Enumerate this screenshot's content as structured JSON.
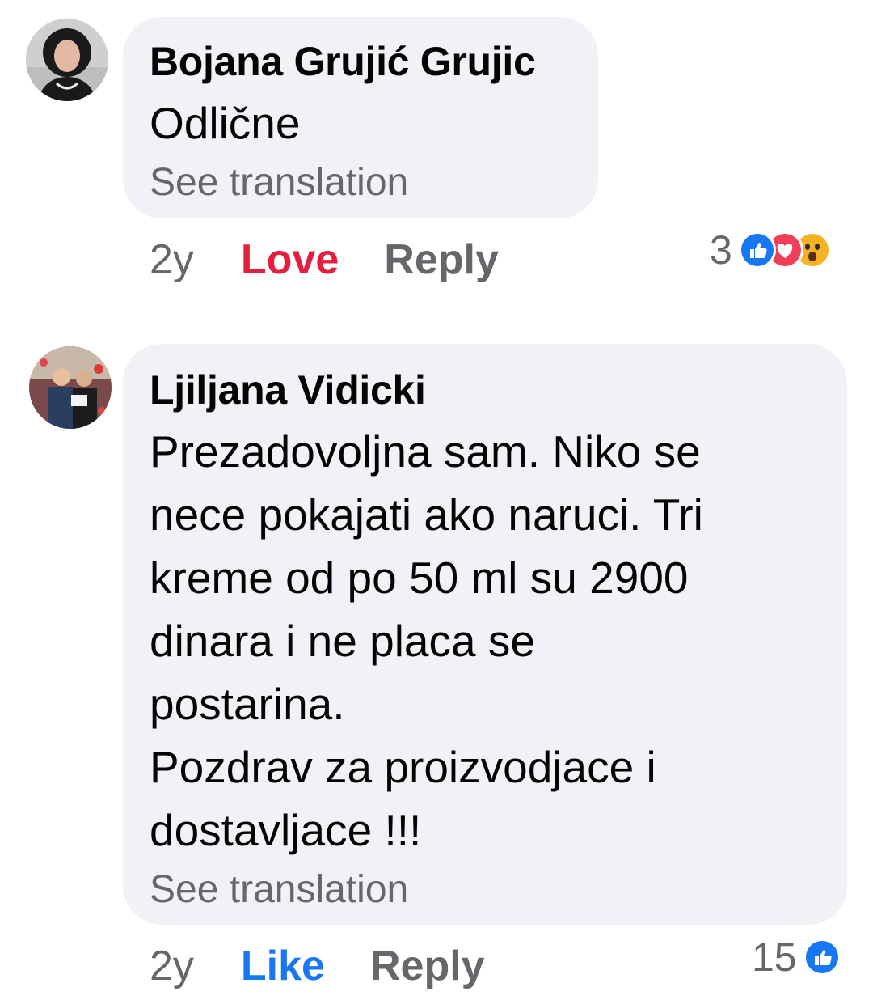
{
  "comments": [
    {
      "author": "Bojana Grujić Grujic",
      "text": "Odlične",
      "see_translation": "See translation",
      "time": "2y",
      "reaction_action": "Love",
      "reply": "Reply",
      "reaction_count": "3",
      "reaction_icons": [
        "like-icon",
        "love-icon",
        "wow-icon"
      ]
    },
    {
      "author": "Ljiljana Vidicki",
      "text": "Prezadovoljna sam. Niko se\nnece pokajati ako naruci. Tri\nkreme od po 50 ml su 2900\ndinara i ne placa se\npostarina.\nPozdrav za proizvodjace i\ndostavljace !!!",
      "see_translation": "See translation",
      "time": "2y",
      "reaction_action": "Like",
      "reply": "Reply",
      "reaction_count": "15",
      "reaction_icons": [
        "like-icon"
      ]
    }
  ],
  "colors": {
    "like": "#1877f2",
    "love": "#e41e3f",
    "bubble": "#f0f2f5",
    "secondary_text": "#65676b"
  }
}
